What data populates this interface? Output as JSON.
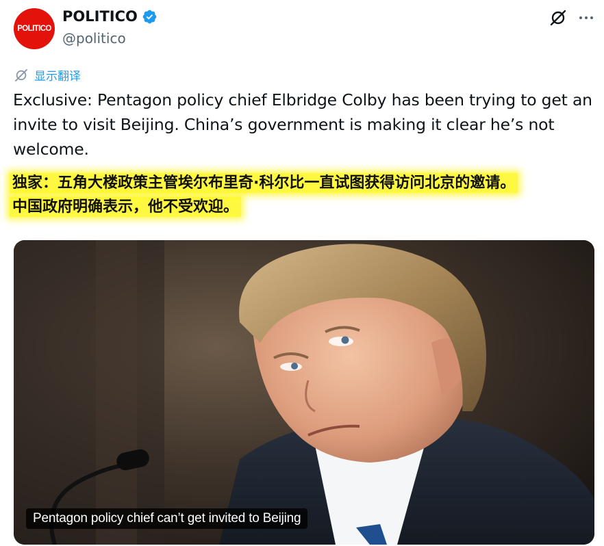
{
  "account": {
    "avatar_text": "POLITICO",
    "display_name": "POLITICO",
    "handle": "@politico",
    "verified": true,
    "brand_color": "#e3120b",
    "verified_color": "#1d9bf0"
  },
  "actions": {
    "grok_icon": "grok-icon",
    "more_icon": "more-icon"
  },
  "translate": {
    "label": "显示翻译",
    "icon": "translate-icon"
  },
  "tweet": {
    "text": "Exclusive: Pentagon policy chief Elbridge Colby has been trying to get an invite to visit Beijing. China’s government is making it clear he’s not welcome.",
    "translation_line1": "独家：五角大楼政策主管埃尔布里奇·科尔比一直试图获得访问北京的邀请。",
    "translation_line2": "中国政府明确表示，他不受欢迎。",
    "highlight_color": "#fff500"
  },
  "media": {
    "caption": "Pentagon policy chief can’t get invited to Beijing"
  }
}
